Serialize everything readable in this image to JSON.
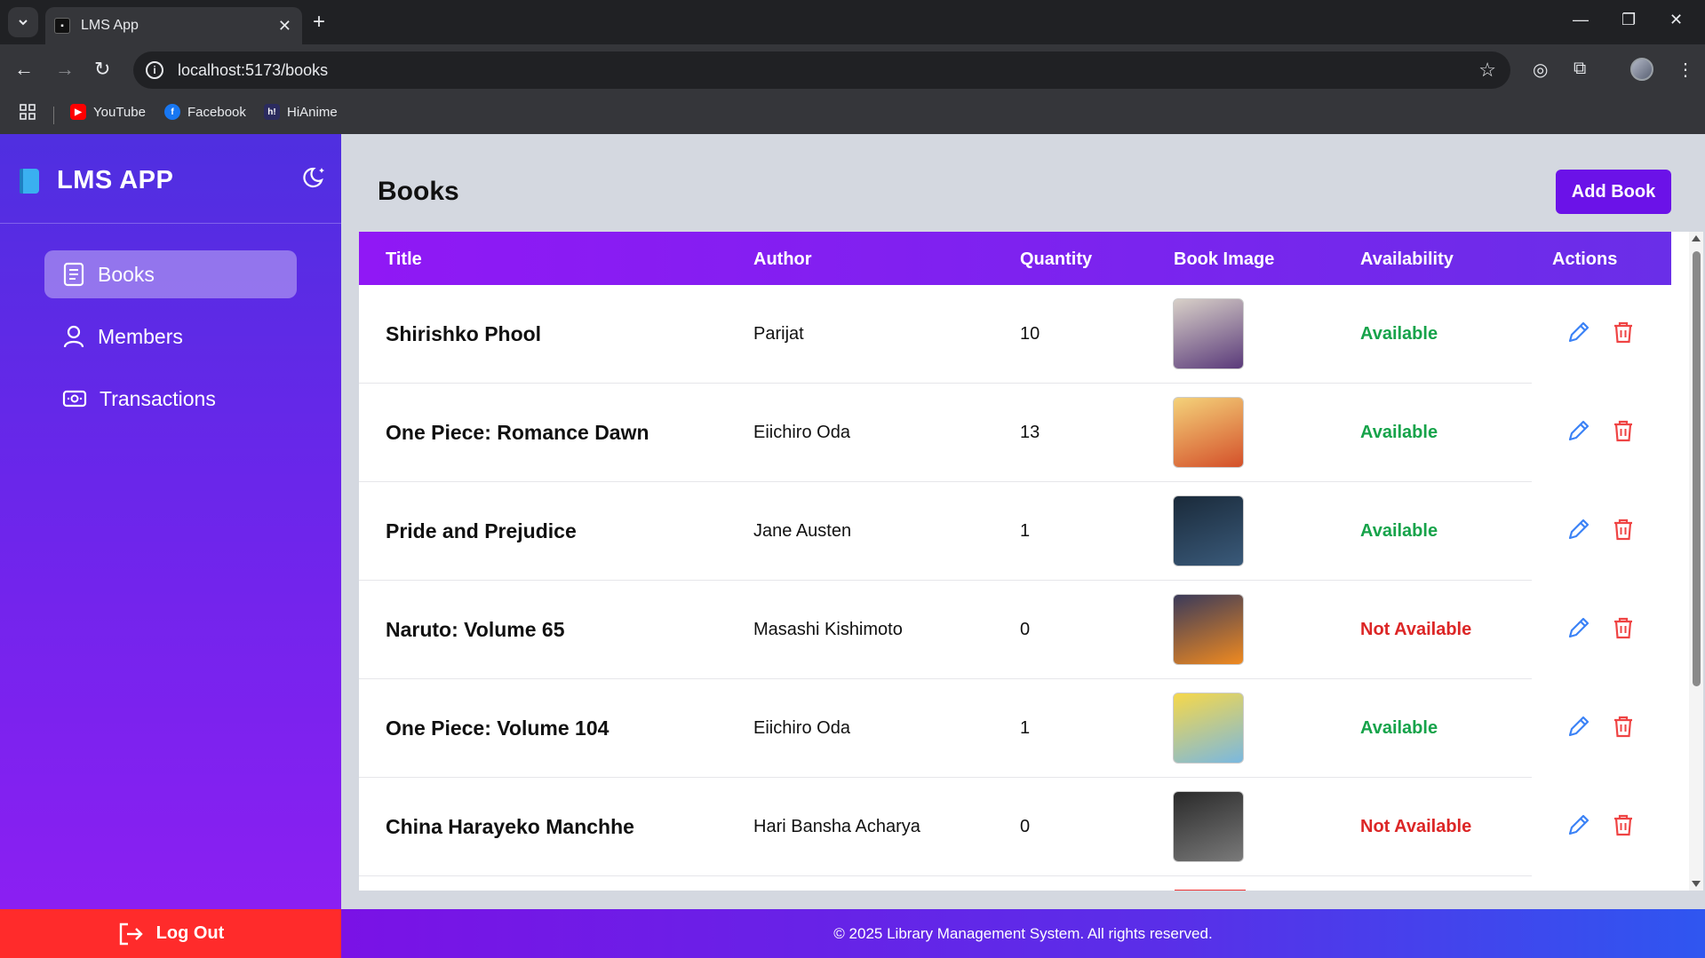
{
  "browser": {
    "tab_title": "LMS App",
    "url": "localhost:5173/books",
    "bookmarks": [
      {
        "label": "YouTube",
        "icon": "youtube-icon",
        "color": "#ff0000"
      },
      {
        "label": "Facebook",
        "icon": "facebook-icon",
        "color": "#1877f2"
      },
      {
        "label": "HiAnime",
        "icon": "hianime-icon",
        "color": "#2b2b5e"
      }
    ]
  },
  "sidebar": {
    "brand": "LMS APP",
    "items": [
      {
        "label": "Books",
        "icon": "document-icon",
        "active": true
      },
      {
        "label": "Members",
        "icon": "user-icon",
        "active": false
      },
      {
        "label": "Transactions",
        "icon": "money-icon",
        "active": false
      }
    ],
    "logout_label": "Log Out"
  },
  "main": {
    "title": "Books",
    "add_button": "Add Book"
  },
  "table": {
    "headers": [
      "Title",
      "Author",
      "Quantity",
      "Book Image",
      "Availability",
      "Actions"
    ],
    "rows": [
      {
        "title": "Shirishko Phool",
        "author": "Parijat",
        "quantity": "10",
        "availability": "Available",
        "available": true,
        "cover": [
          "#d8d0c8",
          "#5a3a7a"
        ]
      },
      {
        "title": "One Piece: Romance Dawn",
        "author": "Eiichiro Oda",
        "quantity": "13",
        "availability": "Available",
        "available": true,
        "cover": [
          "#f4d27a",
          "#d4502a"
        ]
      },
      {
        "title": "Pride and Prejudice",
        "author": "Jane Austen",
        "quantity": "1",
        "availability": "Available",
        "available": true,
        "cover": [
          "#1a2a3a",
          "#3a5a7a"
        ]
      },
      {
        "title": "Naruto: Volume 65",
        "author": "Masashi Kishimoto",
        "quantity": "0",
        "availability": "Not Available",
        "available": false,
        "cover": [
          "#3a3a5a",
          "#f08a20"
        ]
      },
      {
        "title": "One Piece: Volume 104",
        "author": "Eiichiro Oda",
        "quantity": "1",
        "availability": "Available",
        "available": true,
        "cover": [
          "#f6d84a",
          "#7ab8e0"
        ]
      },
      {
        "title": "China Harayeko Manchhe",
        "author": "Hari Bansha Acharya",
        "quantity": "0",
        "availability": "Not Available",
        "available": false,
        "cover": [
          "#2a2a2a",
          "#7a7a7a"
        ]
      }
    ]
  },
  "footer": "© 2025 Library Management System. All rights reserved.",
  "colors": {
    "sidebar_top": "#4f2fe0",
    "sidebar_bottom": "#8b1ff2",
    "header": "#9018f5",
    "add_button": "#6b12e8",
    "logout": "#ff2b2b",
    "available": "#16a34a",
    "not_available": "#dc2626",
    "edit_icon": "#3b82f6",
    "delete_icon": "#ef4444"
  }
}
